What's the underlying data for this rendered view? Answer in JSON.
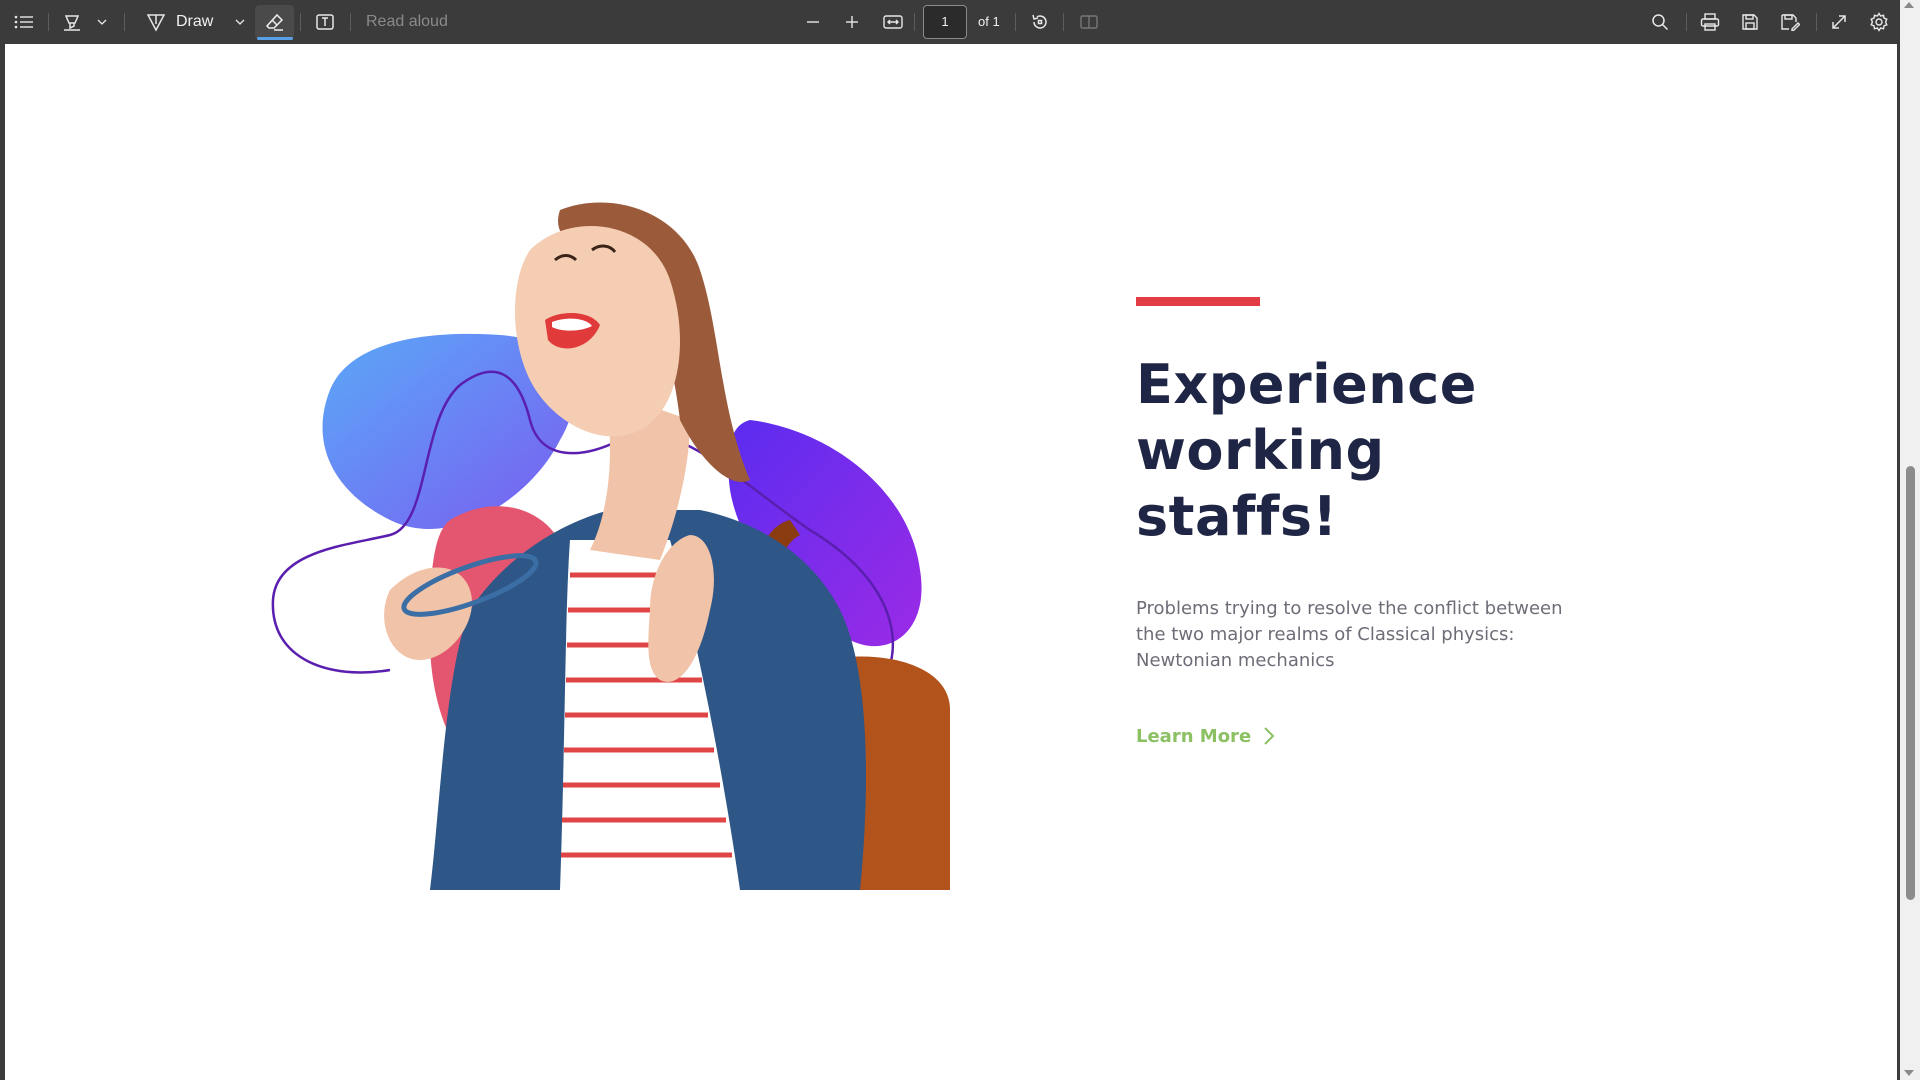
{
  "toolbar": {
    "draw_label": "Draw",
    "read_aloud_label": "Read aloud",
    "page_number": "1",
    "page_of": "of 1",
    "icons": [
      "table-of-contents-icon",
      "highlight-icon",
      "chevron-down-icon",
      "draw-icon",
      "eraser-icon",
      "text-box-icon",
      "zoom-out-icon",
      "zoom-in-icon",
      "fit-to-width-icon",
      "rotate-icon",
      "two-page-icon",
      "search-icon",
      "print-icon",
      "save-icon",
      "save-as-icon",
      "fullscreen-icon",
      "settings-icon"
    ]
  },
  "hero": {
    "headline": [
      "Experience",
      "working",
      "staffs!"
    ],
    "body": [
      "Problems trying to resolve the conflict between",
      "the two major realms of Classical physics:",
      "Newtonian mechanics"
    ],
    "cta_label": "Learn More"
  },
  "colors": {
    "toolbar_bg": "#3b3b3b",
    "accent_red": "#e23c45",
    "headline": "#1f2544",
    "body": "#6d6d78",
    "cta_green": "#8bc063",
    "blob_blue": "#6f8ef5",
    "blob_purple": "#8a2be2",
    "blob_pink": "#e4566f",
    "outline_purple": "#5b1fb0",
    "eraser_active_underline": "#5aa0e6"
  }
}
